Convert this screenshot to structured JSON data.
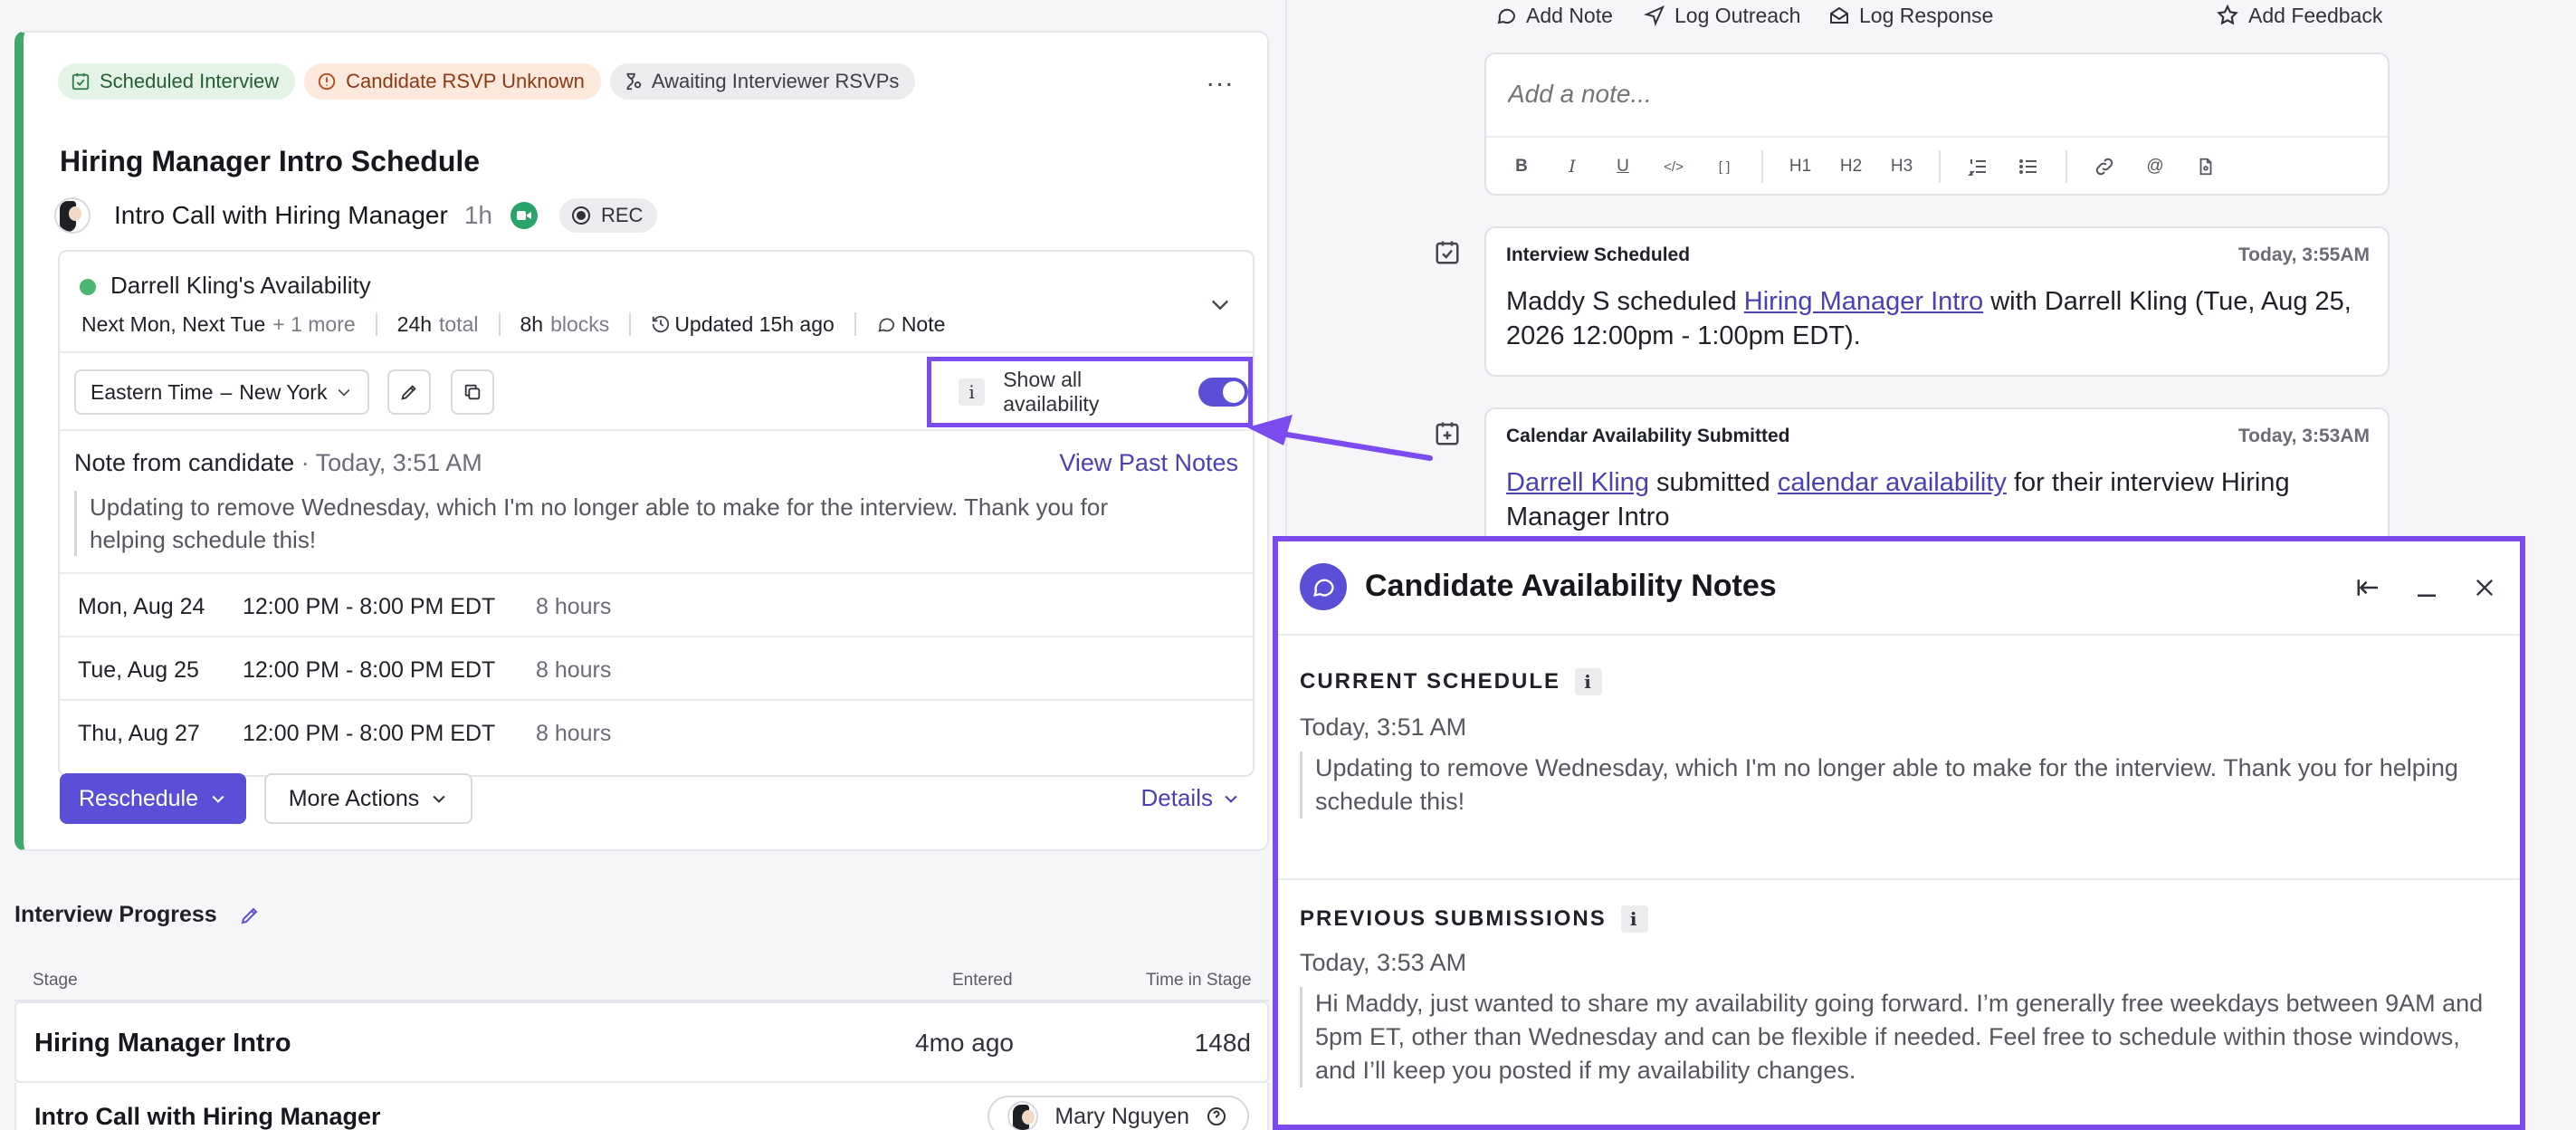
{
  "card": {
    "tags": {
      "scheduled": "Scheduled Interview",
      "rsvp": "Candidate RSVP Unknown",
      "awaiting": "Awaiting Interviewer RSVPs"
    },
    "menu": "...",
    "title": "Hiring Manager Intro Schedule",
    "event": {
      "name": "Intro Call with Hiring Manager",
      "duration": "1h",
      "rec": "REC"
    },
    "availability": {
      "title": "Darrell Kling's Availability",
      "days": "Next Mon, Next Tue",
      "more": "+ 1 more",
      "total_value": "24h",
      "total_label": "total",
      "blocks_value": "8h",
      "blocks_label": "blocks",
      "updated": "Updated 15h ago",
      "note": "Note"
    },
    "timezone": {
      "zone": "Eastern Time",
      "dash": "–",
      "city": "New York"
    },
    "show_all": {
      "info": "i",
      "label": "Show all availability",
      "enabled": true
    },
    "note": {
      "from": "Note from candidate",
      "time": "· Today, 3:51 AM",
      "view_past": "View Past Notes",
      "text": "Updating to remove Wednesday, which I'm no longer able to make for the interview. Thank you for helping schedule this!"
    },
    "slots": [
      {
        "date": "Mon, Aug 24",
        "time": "12:00 PM - 8:00 PM EDT",
        "hours": "8 hours"
      },
      {
        "date": "Tue, Aug 25",
        "time": "12:00 PM - 8:00 PM EDT",
        "hours": "8 hours"
      },
      {
        "date": "Thu, Aug 27",
        "time": "12:00 PM - 8:00 PM EDT",
        "hours": "8 hours"
      }
    ],
    "reschedule": "Reschedule",
    "more_actions": "More Actions",
    "details": "Details"
  },
  "progress": {
    "title": "Interview Progress",
    "headers": {
      "stage": "Stage",
      "entered": "Entered",
      "time": "Time in Stage"
    },
    "rows": [
      {
        "name": "Hiring Manager Intro",
        "entered": "4mo ago",
        "time": "148d"
      },
      {
        "name": "Intro Call with Hiring Manager",
        "person": "Mary Nguyen"
      }
    ]
  },
  "actions": {
    "add_note": "Add Note",
    "log_outreach": "Log Outreach",
    "log_response": "Log Response",
    "add_feedback": "Add Feedback"
  },
  "editor": {
    "placeholder": "Add a note...",
    "toolbar": [
      "B",
      "I",
      "U",
      "</>",
      "[ ]",
      "H1",
      "H2",
      "H3",
      "1.",
      "•",
      "link",
      "@",
      "file"
    ]
  },
  "activity": [
    {
      "kind": "Interview Scheduled",
      "when": "Today, 3:55AM",
      "actor": "Maddy S",
      "verb": "scheduled",
      "link": "Hiring Manager Intro",
      "rest": "with Darrell Kling (Tue, Aug 25, 2026 12:00pm - 1:00pm EDT)."
    },
    {
      "kind": "Calendar Availability Submitted",
      "when": "Today, 3:53AM",
      "actor": "Darrell Kling",
      "verb": "submitted",
      "link": "calendar availability",
      "rest": "for their interview Hiring Manager Intro"
    }
  ],
  "panel": {
    "title": "Candidate Availability Notes",
    "current": {
      "label": "CURRENT SCHEDULE",
      "info": "i",
      "time": "Today, 3:51 AM",
      "text": "Updating to remove Wednesday, which I'm no longer able to make for the interview. Thank you for helping schedule this!"
    },
    "previous": {
      "label": "PREVIOUS SUBMISSIONS",
      "info": "i",
      "time": "Today, 3:53 AM",
      "text": "Hi Maddy, just wanted to share my availability going forward. I’m generally free weekdays between 9AM and 5pm ET, other than Wednesday and can be flexible if needed. Feel free to schedule within those windows, and I’ll keep you posted if my availability changes."
    }
  },
  "colors": {
    "accent": "#5a4fd6",
    "highlight": "#7a4cf0",
    "success": "#3fa86a",
    "link": "#4b3fb5"
  }
}
